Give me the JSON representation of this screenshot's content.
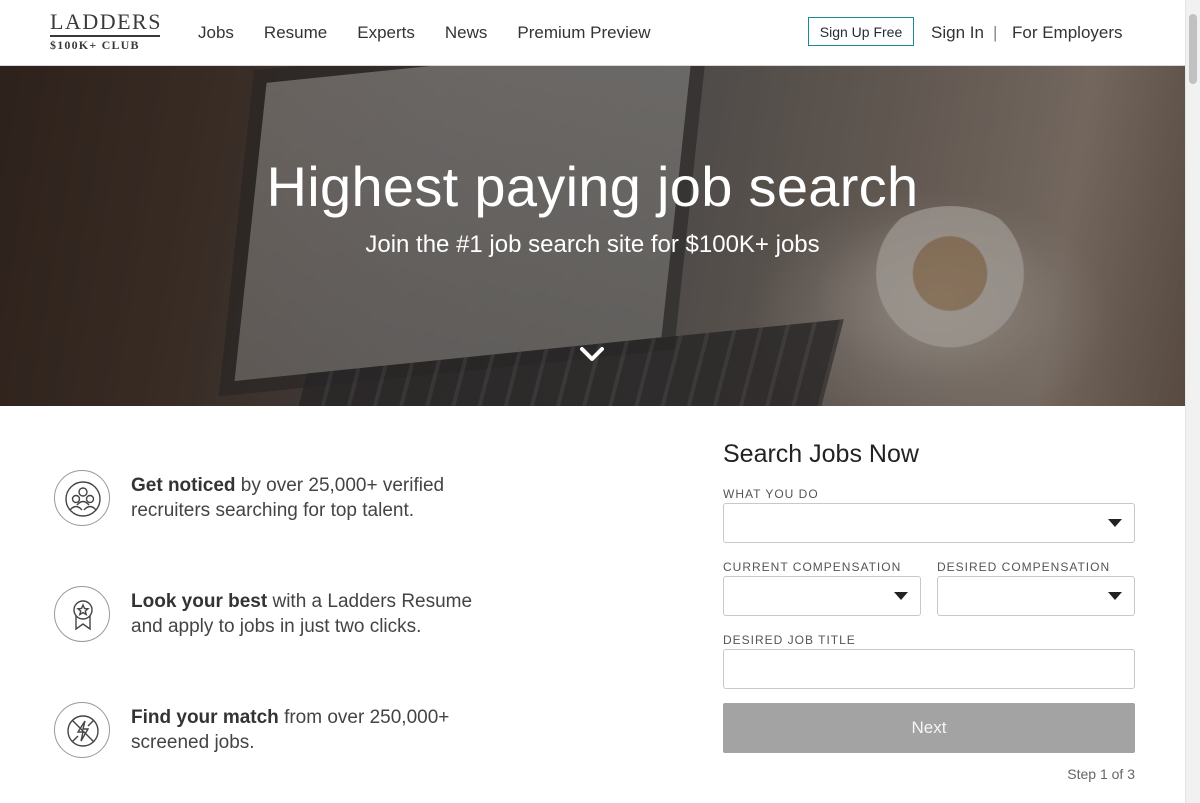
{
  "header": {
    "logo_top": "LADDERS",
    "logo_bottom": "$100K+ CLUB",
    "nav": [
      "Jobs",
      "Resume",
      "Experts",
      "News",
      "Premium Preview"
    ],
    "signup_label": "Sign Up Free",
    "signin_label": "Sign In",
    "separator": "|",
    "employers_label": "For Employers",
    "accent_color": "#1a8a8f"
  },
  "hero": {
    "title": "Highest paying job search",
    "subtitle": "Join the #1 job search site for $100K+ jobs",
    "scroll_icon": "chevron-down-icon"
  },
  "features": [
    {
      "bold": "Get noticed",
      "text": " by over 25,000+ verified recruiters searching for top talent.",
      "icon": "people-group-icon"
    },
    {
      "bold": "Look your best",
      "text": " with a Ladders Resume and apply to jobs in just two clicks.",
      "icon": "award-ribbon-icon"
    },
    {
      "bold": "Find your match",
      "text": " from over 250,000+ screened jobs.",
      "icon": "lightning-match-icon"
    }
  ],
  "search_form": {
    "title": "Search Jobs Now",
    "what_you_do_label": "WHAT YOU DO",
    "current_comp_label": "CURRENT COMPENSATION",
    "desired_comp_label": "DESIRED COMPENSATION",
    "desired_title_label": "DESIRED JOB TITLE",
    "desired_title_value": "",
    "next_label": "Next",
    "step_text": "Step 1 of 3",
    "next_button_color": "#a3a3a3"
  }
}
